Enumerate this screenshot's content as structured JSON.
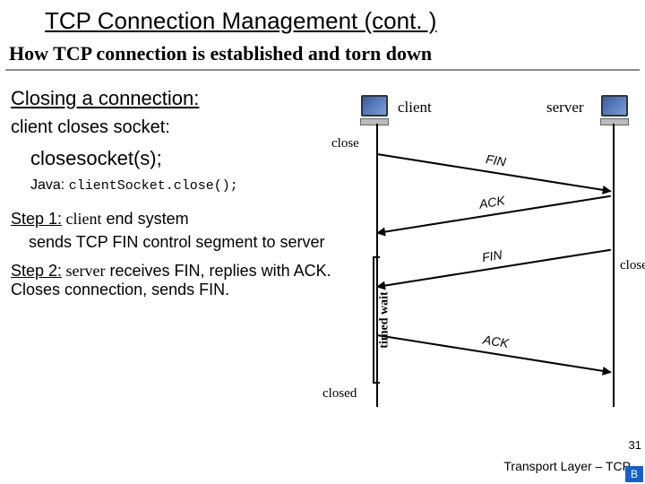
{
  "title": "TCP Connection Management (cont. )",
  "subtitle": "How TCP connection is established and torn down",
  "closing_header": "Closing a connection:",
  "client_closes": "client closes socket:",
  "closesocket": "closesocket(s);",
  "java_prefix": "Java: ",
  "java_code": "clientSocket.close();",
  "step1_label": "Step 1:",
  "step1_rest_a": " client",
  "step1_rest_b": " end system",
  "step1_body": "sends TCP FIN control segment to server",
  "step2_label": "Step 2:",
  "step2_rest_a": " server",
  "step2_rest_b": " receives FIN, replies with ACK. Closes connection, sends FIN.",
  "diagram": {
    "client_label": "client",
    "server_label": "server",
    "close_event_client": "close",
    "close_event_server": "close",
    "closed_event": "closed",
    "timed_wait": "timed wait",
    "messages": {
      "fin1": "FIN",
      "ack1": "ACK",
      "fin2": "FIN",
      "ack2": "ACK"
    }
  },
  "footer": "Transport Layer – TCP",
  "page_number": "31",
  "badge": "B"
}
